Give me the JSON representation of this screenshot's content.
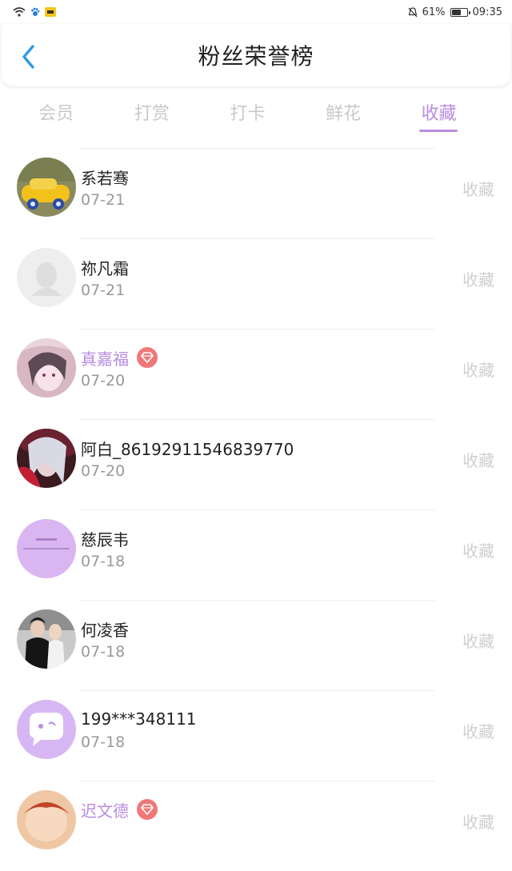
{
  "status_bar": {
    "battery_percent_label": "61%",
    "battery_level": 0.61,
    "time": "09:35"
  },
  "header": {
    "title": "粉丝荣誉榜",
    "back_icon": "chevron-left-icon"
  },
  "tabs": [
    {
      "label": "会员",
      "active": false
    },
    {
      "label": "打赏",
      "active": false
    },
    {
      "label": "打卡",
      "active": false
    },
    {
      "label": "鲜花",
      "active": false
    },
    {
      "label": "收藏",
      "active": true
    }
  ],
  "colors": {
    "accent": "#b98de0",
    "gem": "#f07878",
    "muted": "#cfcfcf"
  },
  "items": [
    {
      "name": "系若骞",
      "date": "07-21",
      "action": "收藏",
      "vip": false
    },
    {
      "name": "祢凡霜",
      "date": "07-21",
      "action": "收藏",
      "vip": false
    },
    {
      "name": "真嘉福",
      "date": "07-20",
      "action": "收藏",
      "vip": true
    },
    {
      "name": "阿白_86192911546839770",
      "date": "07-20",
      "action": "收藏",
      "vip": false
    },
    {
      "name": "慈辰韦",
      "date": "07-18",
      "action": "收藏",
      "vip": false
    },
    {
      "name": "何凌香",
      "date": "07-18",
      "action": "收藏",
      "vip": false
    },
    {
      "name": "199***348111",
      "date": "07-18",
      "action": "收藏",
      "vip": false
    },
    {
      "name": "迟文德",
      "date": "",
      "action": "收藏",
      "vip": true
    }
  ]
}
